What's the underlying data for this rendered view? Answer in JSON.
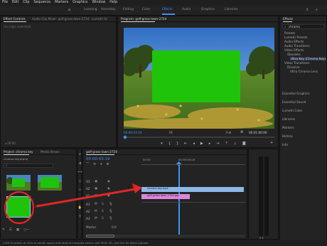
{
  "menubar": [
    "File",
    "Edit",
    "Clip",
    "Sequence",
    "Markers",
    "Graphics",
    "Window",
    "Help"
  ],
  "workspaces": [
    "Learning",
    "Assembly",
    "Editing",
    "Color",
    "Effects",
    "Audio",
    "Graphics",
    "Libraries"
  ],
  "active_workspace": "Effects",
  "source_panel": {
    "tabs": [
      "Effect Controls",
      "Audio Clip Mixer: golf-grass-lawn-2724",
      "Lumetri Sc"
    ],
    "subtitle": "(no clips selected)"
  },
  "program": {
    "tab": "Program: golf-grass-lawn-2724",
    "timecode": "00:00:03:19",
    "fit": "Fit",
    "quality": "Full",
    "duration": "00:01:00:00"
  },
  "effects": {
    "title": "Effects",
    "search_placeholder": "chroma",
    "tree": [
      "Presets",
      "Lumetri Presets",
      "Audio Effects",
      "Audio Transitions",
      "Video Effects",
      "Obsolete",
      "Ultra Key (Chroma Key)",
      "Video Transitions",
      "Dissolve",
      "Ultra Chroma Lens"
    ],
    "sections": [
      "Essential Graphics",
      "Essential Sound",
      "Lumetri Color",
      "Libraries",
      "Markers",
      "History",
      "Info"
    ]
  },
  "project": {
    "tabs": [
      "Project: chroma key",
      "Media Brows"
    ],
    "path": "chroma key.prproj",
    "search_placeholder": ""
  },
  "timeline": {
    "tab": "golf-grass-lawn-2724",
    "timecode": "00:00:03:19",
    "ruler": [
      "00:00",
      "00:00:05:00"
    ],
    "video_tracks": [
      "V3",
      "V2",
      "V1"
    ],
    "audio_tracks": [
      "A1",
      "A2",
      "A3"
    ],
    "master_label": "Master",
    "master_value": "0.0",
    "clips": [
      {
        "name": "chroma key.mp4",
        "color": "#8db7e6"
      },
      {
        "name": "golf-grass-lawn-2724.jpg",
        "color": "#dd84dd"
      }
    ]
  },
  "statusbar": "Click to select, or click in empty space and drag to marquee select. Use Shift, Alt, and Ctrl for other options.",
  "colors": {
    "accent": "#3d93f0",
    "chroma_green": "#1fc40a",
    "arrow": "#e02727",
    "circle": "#e02727"
  }
}
